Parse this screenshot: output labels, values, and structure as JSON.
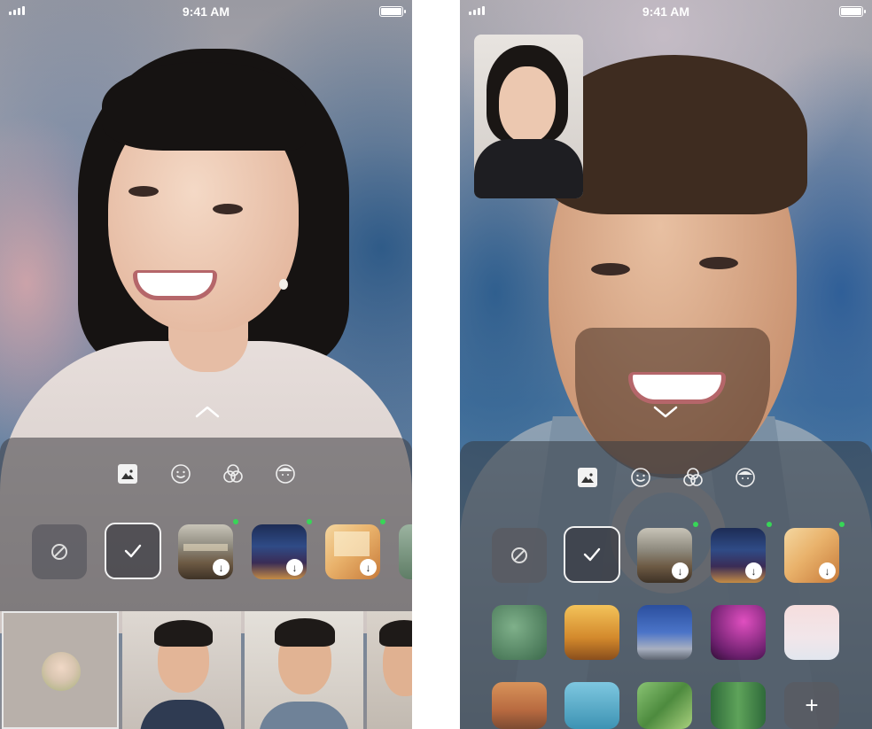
{
  "left_screen": {
    "status": {
      "time": "9:41 AM"
    },
    "tabs": [
      {
        "name": "background-icon",
        "active": true
      },
      {
        "name": "emoji-effect-icon",
        "active": false
      },
      {
        "name": "filters-icon",
        "active": false
      },
      {
        "name": "avatar-icon",
        "active": false
      }
    ],
    "backgrounds": [
      {
        "kind": "none",
        "name": "background-none"
      },
      {
        "kind": "selected",
        "name": "background-blur-selected"
      },
      {
        "kind": "image",
        "name": "background-library",
        "download": "↓",
        "new": true
      },
      {
        "kind": "image",
        "name": "background-city-night",
        "download": "↓",
        "new": true
      },
      {
        "kind": "image",
        "name": "background-living-room",
        "download": "↓",
        "new": true
      }
    ],
    "participants": [
      "self-preview",
      "participant-1",
      "participant-2",
      "participant-3"
    ]
  },
  "right_screen": {
    "status": {
      "time": "9:41 AM"
    },
    "tabs": [
      {
        "name": "background-icon",
        "active": true
      },
      {
        "name": "emoji-effect-icon",
        "active": false
      },
      {
        "name": "filters-icon",
        "active": false
      },
      {
        "name": "avatar-icon",
        "active": false
      }
    ],
    "add_label": "+",
    "backgrounds_row1": [
      {
        "kind": "none",
        "name": "background-none"
      },
      {
        "kind": "selected",
        "name": "background-blur-selected"
      },
      {
        "kind": "image",
        "name": "background-library",
        "download": "↓",
        "new": true
      },
      {
        "kind": "image",
        "name": "background-city-night",
        "download": "↓",
        "new": true
      },
      {
        "kind": "image",
        "name": "background-living-room",
        "download": "↓",
        "new": true
      }
    ],
    "backgrounds_row2": [
      "background-green-leaves",
      "background-autumn-forest",
      "background-city-street",
      "background-neon-pink",
      "background-snow-scene"
    ],
    "backgrounds_row3": [
      "background-cartoon-room",
      "background-ocean",
      "background-green-fields",
      "background-forest-road"
    ]
  },
  "colors": {
    "new_dot": "#37d657",
    "panel": "rgba(60,60,66,0.55)"
  }
}
